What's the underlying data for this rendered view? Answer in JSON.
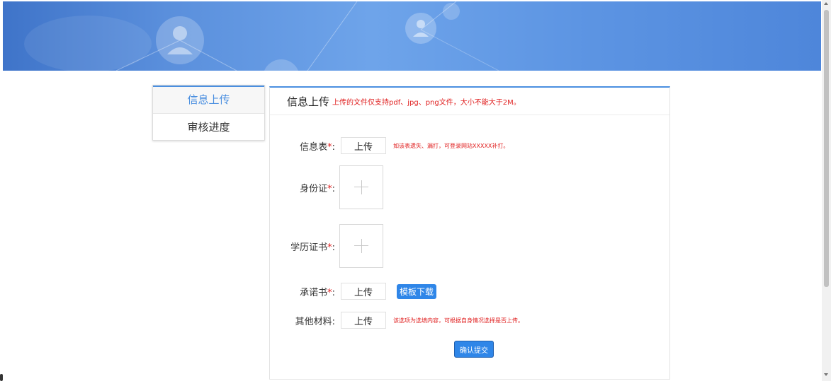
{
  "nav": {
    "items": [
      {
        "label": "信息上传",
        "active": true
      },
      {
        "label": "审核进度",
        "active": false
      }
    ]
  },
  "panel": {
    "title": "信息上传",
    "hint": "上传的文件仅支持pdf、jpg、png文件，大小不能大于2M。"
  },
  "form": {
    "info_sheet": {
      "label": "信息表",
      "required_mark": "*",
      "colon": ":",
      "button": "上传",
      "tip": "如该表遗失、漏打，可登录网站XXXXX补打。"
    },
    "id_card": {
      "label": "身份证",
      "required_mark": "*",
      "colon": ":"
    },
    "diploma": {
      "label": "学历证书",
      "required_mark": "*",
      "colon": ":"
    },
    "pledge": {
      "label": "承诺书",
      "required_mark": "*",
      "colon": ":",
      "button": "上传",
      "template_button": "模板下载"
    },
    "other": {
      "label": "其他材料",
      "colon": ":",
      "button": "上传",
      "tip": "该选项为选填内容，可根据自身情况选择是否上传。"
    },
    "submit": "确认提交"
  },
  "colors": {
    "accent": "#4a8fe0",
    "button_blue": "#2f86e8",
    "required_red": "#e02020"
  }
}
